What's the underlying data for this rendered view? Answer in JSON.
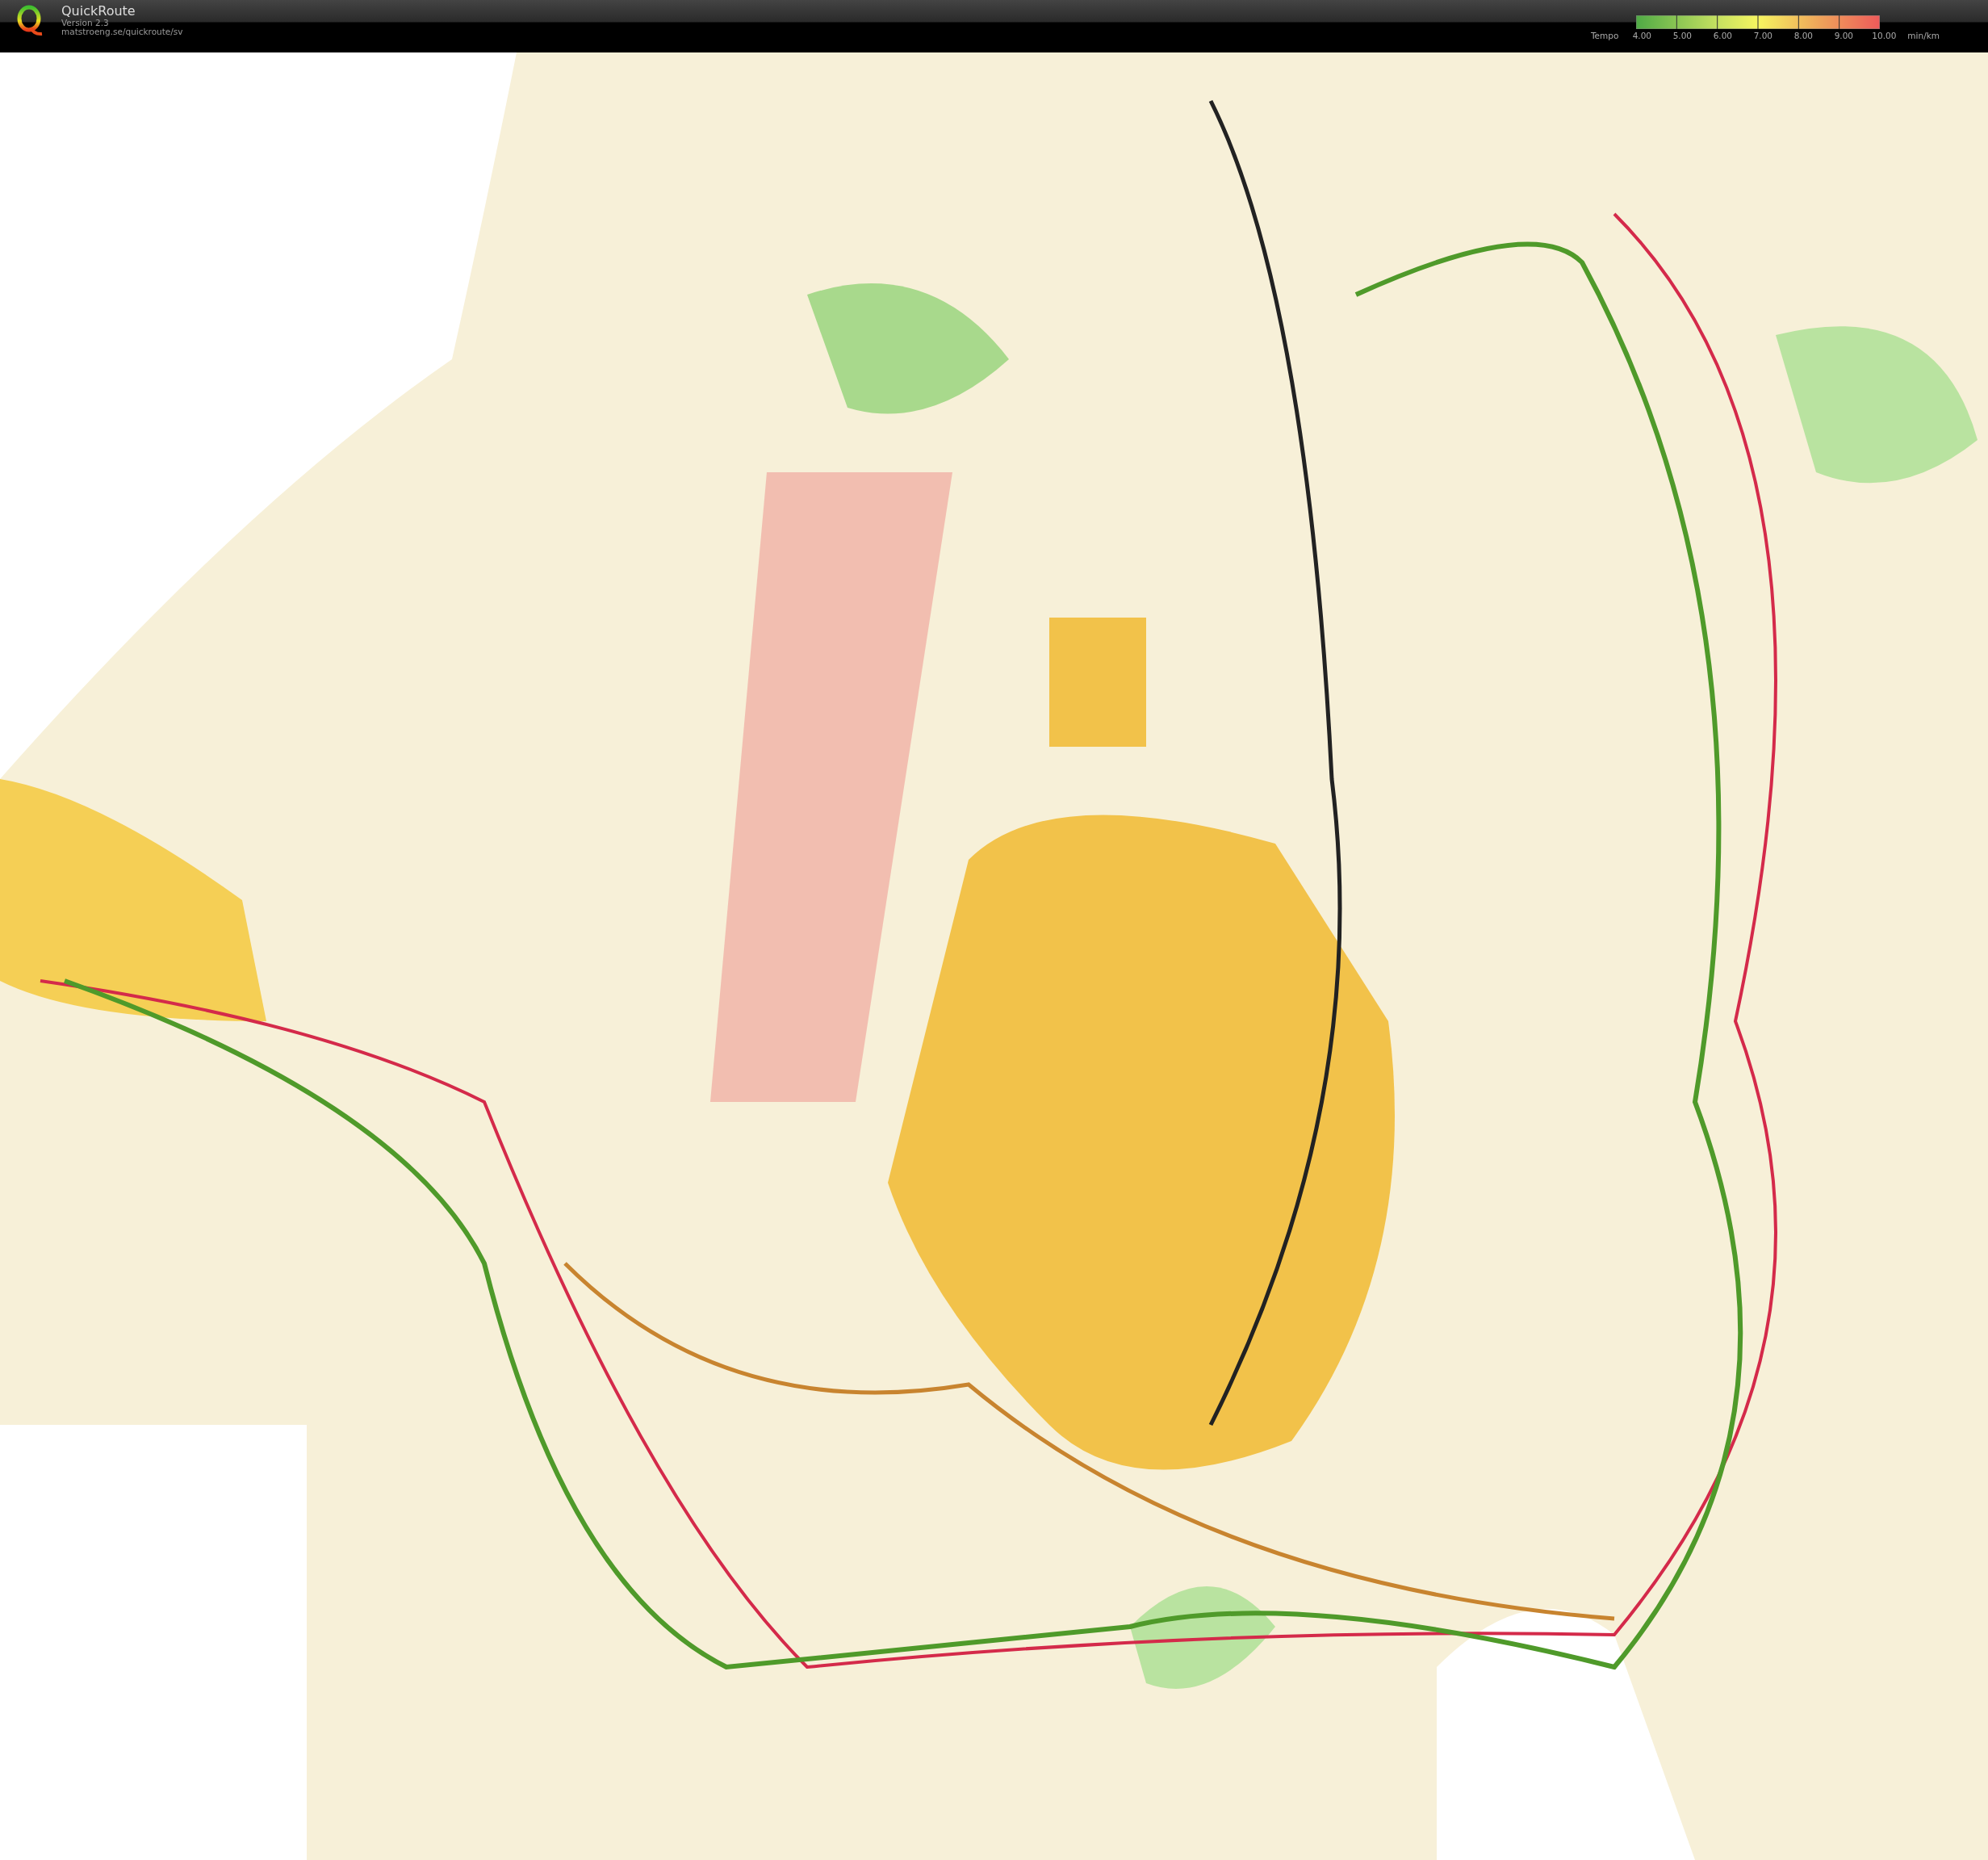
{
  "app": {
    "name": "QuickRoute",
    "version": "Version 2.3",
    "url": "matstroeng.se/quickroute/sv"
  },
  "tempo_legend": {
    "label": "Tempo",
    "ticks": [
      "4.00",
      "5.00",
      "6.00",
      "7.00",
      "8.00",
      "9.00",
      "10.00"
    ],
    "unit": "min/km"
  }
}
